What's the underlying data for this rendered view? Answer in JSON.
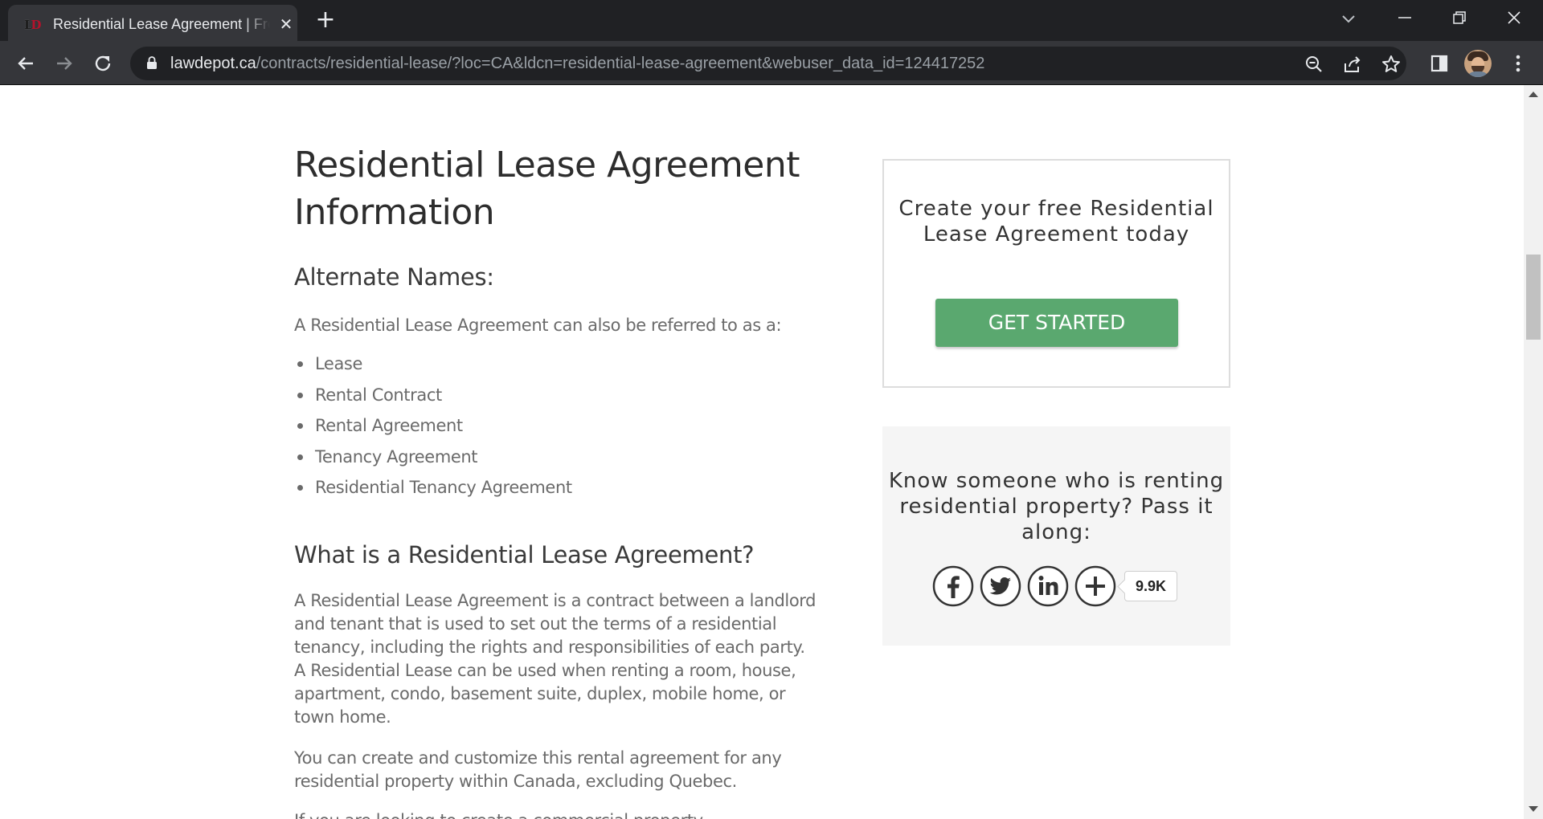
{
  "browser": {
    "tab": {
      "title": "Residential Lease Agreement | Free Rental Agreement (Canada)"
    },
    "url": {
      "host": "lawdepot.ca",
      "path": "/contracts/residential-lease/?loc=CA&ldcn=residential-lease-agreement&webuser_data_id=124417252"
    }
  },
  "page": {
    "title": "Residential Lease Agreement Information",
    "alt_names_heading": "Alternate Names:",
    "alt_names_intro": "A Residential Lease Agreement can also be referred to as a:",
    "alt_names": [
      "Lease",
      "Rental Contract",
      "Rental Agreement",
      "Tenancy Agreement",
      "Residential Tenancy Agreement"
    ],
    "what_is_heading": "What is a Residential Lease Agreement?",
    "what_is_p1": "A Residential Lease Agreement is a contract between a landlord and tenant that is used to set out the terms of a residential tenancy, including the rights and responsibilities of each party. A Residential Lease can be used when renting a room, house, apartment, condo, basement suite, duplex, mobile home, or town home.",
    "what_is_p2": "You can create and customize this rental agreement for any residential property within Canada, excluding Quebec.",
    "what_is_p3_partial": "If you are looking to create a commercial property"
  },
  "sidebar": {
    "cta_text": "Create your free Residential Lease Agreement today",
    "cta_button": "GET STARTED",
    "share_text": "Know someone who is renting residential property? Pass it along:",
    "share_count": "9.9K",
    "social_icons": [
      "facebook-icon",
      "twitter-icon",
      "linkedin-icon",
      "plus-icon"
    ]
  },
  "colors": {
    "cta_green": "#5aa86f",
    "chrome_dark": "#202124",
    "chrome_toolbar": "#35363a"
  }
}
